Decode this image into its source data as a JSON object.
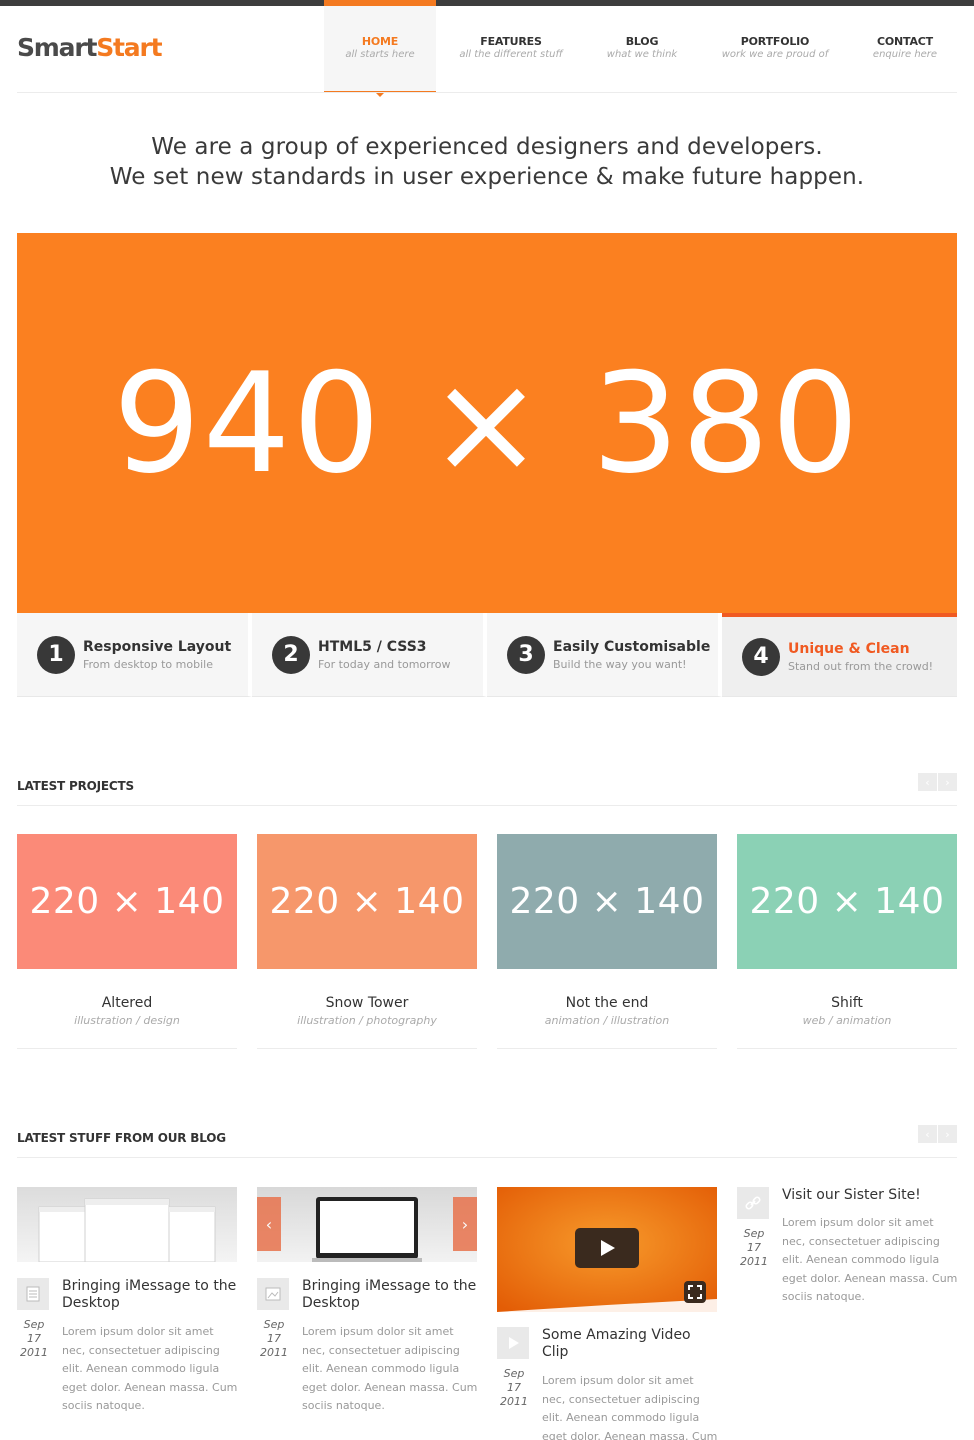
{
  "brand": {
    "part1": "Smart",
    "part2": "Start"
  },
  "nav": [
    {
      "label": "HOME",
      "sub": "all starts here",
      "active": true
    },
    {
      "label": "FEATURES",
      "sub": "all the different stuff"
    },
    {
      "label": "BLOG",
      "sub": "what we think"
    },
    {
      "label": "PORTFOLIO",
      "sub": "work we are proud of"
    },
    {
      "label": "CONTACT",
      "sub": "enquire here"
    }
  ],
  "tagline": {
    "line1": "We are a group of experienced designers and developers.",
    "line2": "We set new standards in user experience & make future happen."
  },
  "hero": {
    "text": "940 × 380",
    "color": "#fb8020"
  },
  "features": [
    {
      "num": "1",
      "title": "Responsive Layout",
      "sub": "From desktop to mobile"
    },
    {
      "num": "2",
      "title": "HTML5 / CSS3",
      "sub": "For today and tomorrow"
    },
    {
      "num": "3",
      "title": "Easily Customisable",
      "sub": "Build the way you want!"
    },
    {
      "num": "4",
      "title": "Unique & Clean",
      "sub": "Stand out from the crowd!",
      "active": true
    }
  ],
  "projects_section": {
    "title": "LATEST PROJECTS",
    "prev": "‹",
    "next": "›"
  },
  "projects": [
    {
      "thumb": "220 × 140",
      "name": "Altered",
      "tags": "illustration / design",
      "color": "#fb8a78"
    },
    {
      "thumb": "220 × 140",
      "name": "Snow Tower",
      "tags": "illustration / photography",
      "color": "#f6976b"
    },
    {
      "thumb": "220 × 140",
      "name": "Not the end",
      "tags": "animation / illustration",
      "color": "#8fabad"
    },
    {
      "thumb": "220 × 140",
      "name": "Shift",
      "tags": "web / animation",
      "color": "#8bd1b5"
    }
  ],
  "blog_section": {
    "title": "LATEST STUFF FROM OUR BLOG",
    "prev": "‹",
    "next": "›"
  },
  "posts": [
    {
      "title": "Bringing iMessage to the Desktop",
      "month": "Sep",
      "day": "17",
      "year": "2011",
      "icon": "document-icon",
      "excerpt": "Lorem ipsum dolor sit amet nec, consectetuer adipiscing elit. Aenean commodo ligula eget dolor. Aenean massa. Cum sociis natoque."
    },
    {
      "title": "Bringing iMessage to the Desktop",
      "month": "Sep",
      "day": "17",
      "year": "2011",
      "icon": "gallery-icon",
      "excerpt": "Lorem ipsum dolor sit amet nec, consectetuer adipiscing elit. Aenean commodo ligula eget dolor. Aenean massa. Cum sociis natoque."
    },
    {
      "title": "Some Amazing Video Clip",
      "month": "Sep",
      "day": "17",
      "year": "2011",
      "icon": "play-icon",
      "excerpt": "Lorem ipsum dolor sit amet nec, consectetuer adipiscing elit. Aenean commodo ligula eget dolor. Aenean massa. Cum"
    },
    {
      "title": "Visit our Sister Site!",
      "month": "Sep",
      "day": "17",
      "year": "2011",
      "icon": "link-icon",
      "excerpt": "Lorem ipsum dolor sit amet nec, consectetuer adipiscing elit. Aenean commodo ligula eget dolor. Aenean massa. Cum sociis natoque."
    }
  ],
  "colors": {
    "accent": "#f47a20",
    "accent_red": "#f05a22",
    "dark": "#383838"
  }
}
